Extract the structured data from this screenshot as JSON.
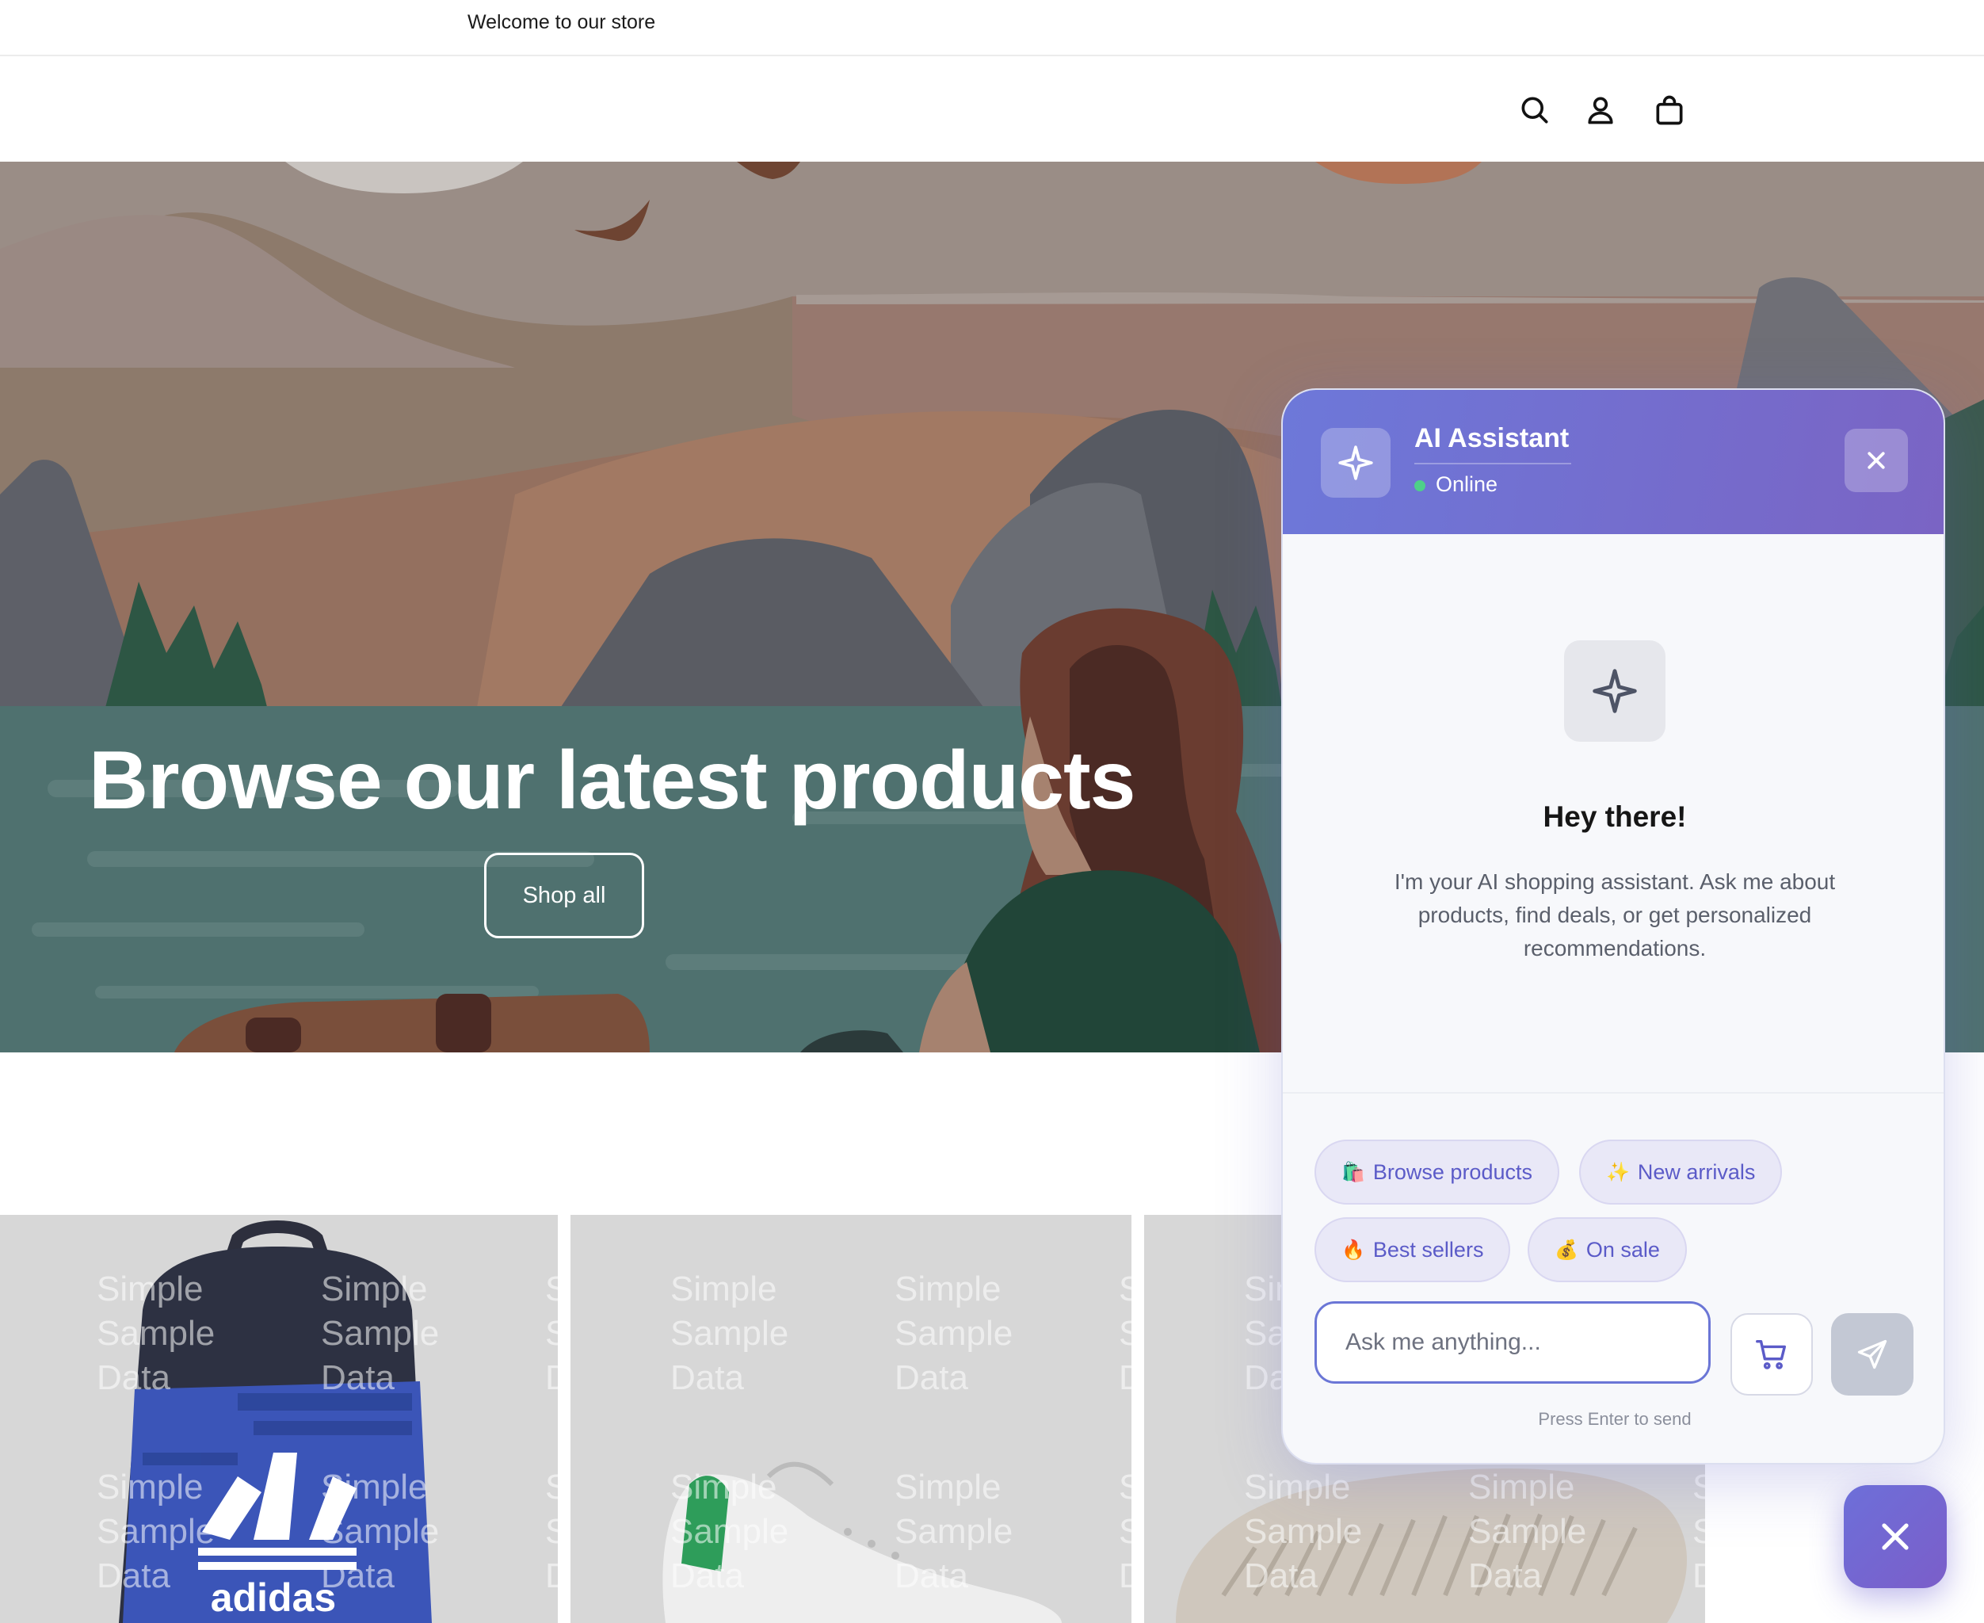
{
  "announcement": {
    "text": "Welcome to our store"
  },
  "header": {
    "icons": [
      "search-icon",
      "account-icon",
      "cart-icon"
    ]
  },
  "hero": {
    "title": "Browse our latest products",
    "cta_label": "Shop all"
  },
  "products": {
    "watermark": "Simple\nSample\nData",
    "items": [
      {
        "image": "backpack",
        "brand_print": "adidas"
      },
      {
        "image": "sneaker"
      },
      {
        "image": "shoe-sole"
      }
    ]
  },
  "chat": {
    "title": "AI Assistant",
    "status": "Online",
    "welcome_title": "Hey there!",
    "welcome_text": "I'm your AI shopping assistant. Ask me about products, find deals, or get personalized recommendations.",
    "chips": [
      {
        "emoji": "🛍️",
        "label": "Browse products"
      },
      {
        "emoji": "✨",
        "label": "New arrivals"
      },
      {
        "emoji": "🔥",
        "label": "Best sellers"
      },
      {
        "emoji": "💰",
        "label": "On sale"
      }
    ],
    "input_placeholder": "Ask me anything...",
    "hint": "Press Enter to send",
    "colors": {
      "header_start": "#6d78d9",
      "header_end": "#7a64c4",
      "accent": "#5b5bc8",
      "online": "#4ed089"
    }
  }
}
